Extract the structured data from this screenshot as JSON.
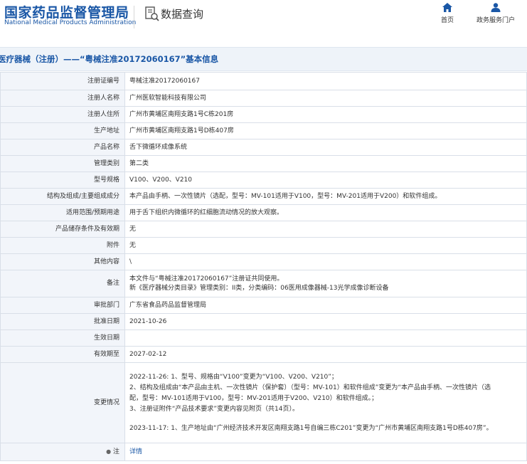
{
  "header": {
    "logo_cn": "国家药品监督管理局",
    "logo_en": "National Medical Products Administration",
    "section_title": "数据查询",
    "nav_home": "首页",
    "nav_portal": "政务服务门户"
  },
  "title": "医疗器械（注册）——“粤械注准20172060167”基本信息",
  "fields": {
    "reg_no": {
      "label": "注册证编号",
      "value": "粤械注准20172060167"
    },
    "registrant": {
      "label": "注册人名称",
      "value": "广州医软智能科技有限公司"
    },
    "registrant_addr": {
      "label": "注册人住所",
      "value": "广州市黄埔区南翔支路1号C栋201房"
    },
    "production_addr": {
      "label": "生产地址",
      "value": "广州市黄埔区南翔支路1号D栋407房"
    },
    "product_name": {
      "label": "产品名称",
      "value": "舌下微循环成像系统"
    },
    "category": {
      "label": "管理类别",
      "value": "第二类"
    },
    "model": {
      "label": "型号规格",
      "value": "V100、V200、V210"
    },
    "structure": {
      "label": "结构及组成/主要组成成分",
      "value": "本产品由手柄、一次性镜片（选配，型号：MV-101适用于V100，型号：MV-201适用于V200）和软件组成。"
    },
    "scope": {
      "label": "适用范围/预期用途",
      "value": "用于舌下组织内微循环的红细胞流动情况的放大观察。"
    },
    "storage": {
      "label": "产品储存条件及有效期",
      "value": "无"
    },
    "attachment": {
      "label": "附件",
      "value": "无"
    },
    "other": {
      "label": "其他内容",
      "value": "\\"
    },
    "remark": {
      "label": "备注",
      "line1": "本文件与“粤械注准20172060167”注册证共同使用。",
      "line2": "新《医疗器械分类目录》管理类别：II类，分类编码：06医用成像器械-13光学成像诊断设备"
    },
    "approval_dept": {
      "label": "审批部门",
      "value": "广东省食品药品监督管理局"
    },
    "approval_date": {
      "label": "批准日期",
      "value": "2021-10-26"
    },
    "effective_date": {
      "label": "生效日期",
      "value": ""
    },
    "valid_until": {
      "label": "有效期至",
      "value": "2027-02-12"
    },
    "changes": {
      "label": "变更情况",
      "line1": "2022-11-26: 1、型号、规格由“V100”变更为“V100、V200、V210”；",
      "line2": "2、结构及组成由“本产品由主机、一次性镜片（保护套）（型号：MV-101）和软件组成”变更为“本产品由手柄、一次性镜片（选",
      "line3": "配，型号：MV-101适用于V100，型号：MV-201适用于V200、V210）和软件组成。；",
      "line4": "3、注册证附件“产品技术要求”变更内容见附页（共14页）。",
      "line5": "2023-11-17: 1、生产地址由“广州经济技术开发区南翔支路1号自编三栋C201”变更为“广州市黄埔区南翔支路1号D栋407房”。"
    },
    "note": {
      "label": "注",
      "value": "详情"
    }
  }
}
